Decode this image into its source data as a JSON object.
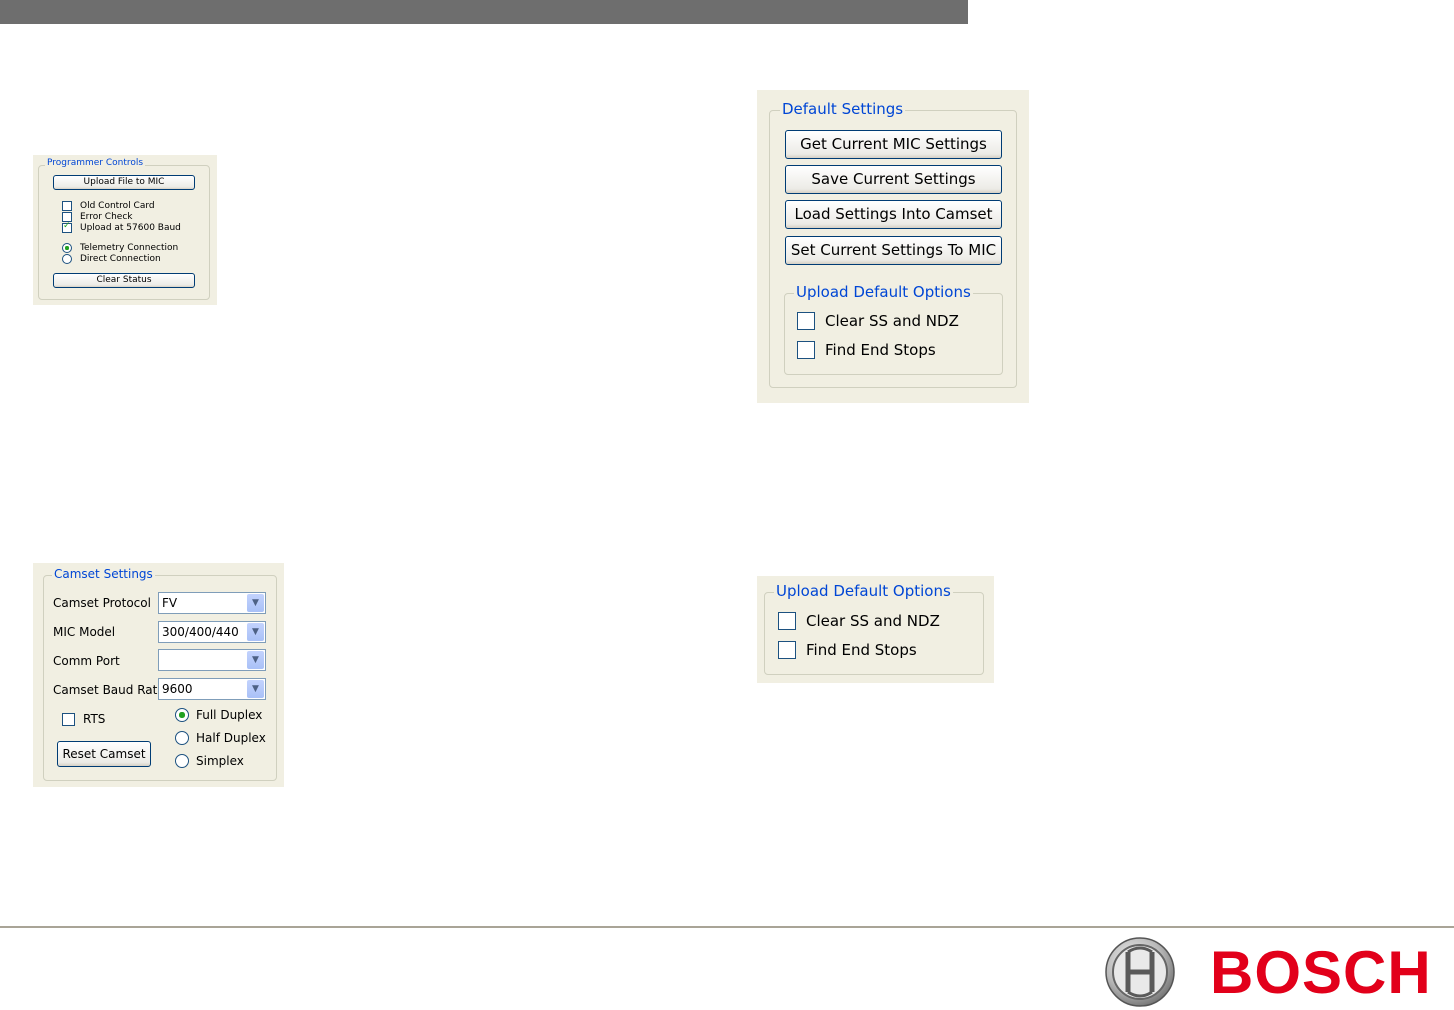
{
  "programmer_controls": {
    "title": "Programmer Controls",
    "upload_button": "Upload File to MIC",
    "checkboxes": [
      {
        "label": "Old Control Card",
        "checked": false
      },
      {
        "label": "Error Check",
        "checked": false
      },
      {
        "label": "Upload at 57600 Baud",
        "checked": true
      }
    ],
    "radios": [
      {
        "label": "Telemetry Connection",
        "selected": true
      },
      {
        "label": "Direct Connection",
        "selected": false
      }
    ],
    "clear_button": "Clear Status"
  },
  "default_settings": {
    "title": "Default Settings",
    "buttons": [
      "Get Current MIC Settings",
      "Save Current Settings",
      "Load Settings Into Camset",
      "Set Current Settings To MIC"
    ],
    "upload_options": {
      "title": "Upload Default Options",
      "checkboxes": [
        {
          "label": "Clear SS and NDZ",
          "checked": false
        },
        {
          "label": "Find End Stops",
          "checked": false
        }
      ]
    }
  },
  "camset_settings": {
    "title": "Camset Settings",
    "fields": [
      {
        "label": "Camset Protocol",
        "value": "FV"
      },
      {
        "label": "MIC Model",
        "value": "300/400/440"
      },
      {
        "label": "Comm Port",
        "value": ""
      },
      {
        "label": "Camset Baud Rate",
        "value": "9600"
      }
    ],
    "rts": {
      "label": "RTS",
      "checked": false
    },
    "reset_button": "Reset Camset",
    "radios": [
      {
        "label": "Full Duplex",
        "selected": true
      },
      {
        "label": "Half Duplex",
        "selected": false
      },
      {
        "label": "Simplex",
        "selected": false
      }
    ]
  },
  "upload_default_options": {
    "title": "Upload Default Options",
    "checkboxes": [
      {
        "label": "Clear SS and NDZ",
        "checked": false
      },
      {
        "label": "Find End Stops",
        "checked": false
      }
    ]
  },
  "branding": {
    "logo_text": "BOSCH",
    "brand_color": "#e2001a",
    "logo_icon": "bosch-armature-icon"
  }
}
